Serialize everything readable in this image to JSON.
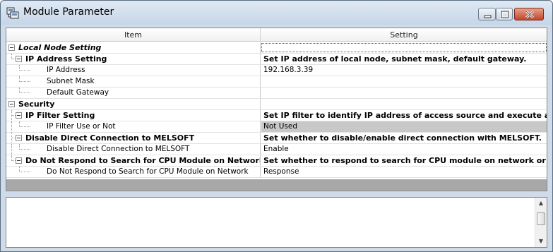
{
  "window": {
    "title": "Module Parameter",
    "icon": "module-parameter-icon"
  },
  "grid": {
    "col_item": "Item",
    "col_setting": "Setting",
    "rows": [
      {
        "label": "Local Node Setting",
        "setting": ""
      },
      {
        "label": "IP Address Setting",
        "setting": "Set IP address of local node, subnet mask, default gateway."
      },
      {
        "label": "IP Address",
        "setting": "192.168.3.39"
      },
      {
        "label": "Subnet Mask",
        "setting": ""
      },
      {
        "label": "Default Gateway",
        "setting": ""
      },
      {
        "label": "Security",
        "setting": ""
      },
      {
        "label": "IP Filter Setting",
        "setting": "Set IP filter to identify IP address of access source and execute ac..."
      },
      {
        "label": "IP Filter Use or Not",
        "setting": "Not Used"
      },
      {
        "label": "Disable Direct Connection to MELSOFT",
        "setting": "Set whether to disable/enable direct connection with MELSOFT."
      },
      {
        "label": "Disable Direct Connection to MELSOFT",
        "setting": "Enable"
      },
      {
        "label": "Do Not Respond to Search for CPU Module on Network",
        "setting": "Set whether to respond to search for CPU module on network or not."
      },
      {
        "label": "Do Not Respond to Search for CPU Module on Network",
        "setting": "Response"
      }
    ]
  },
  "description": {
    "text": ""
  },
  "colors": {
    "title_bar": "#c6d6e8",
    "disabled_cell": "#c8c8c8",
    "status_bar": "#a8a8a8"
  }
}
